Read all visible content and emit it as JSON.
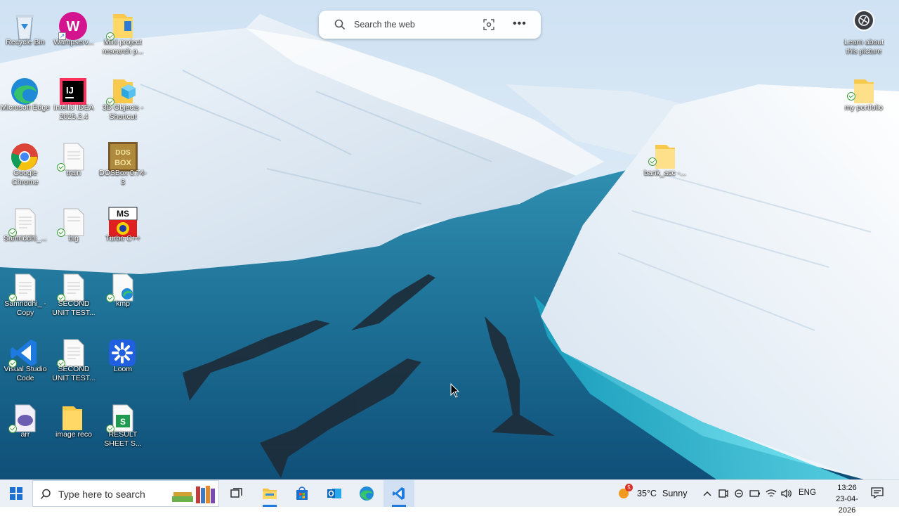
{
  "desktop": {
    "icons": [
      {
        "label": "Recycle Bin"
      },
      {
        "label": "Wampserv..."
      },
      {
        "label": "Mini project research p..."
      },
      {
        "label": "Microsoft Edge"
      },
      {
        "label": "IntelliJ IDEA 2025.2.4"
      },
      {
        "label": "3D Objects - Shortcut"
      },
      {
        "label": "Google Chrome"
      },
      {
        "label": "train"
      },
      {
        "label": "DOSBox 0.74-3"
      },
      {
        "label": "Samriddhi_..."
      },
      {
        "label": "big"
      },
      {
        "label": "Turbo C++"
      },
      {
        "label": "Samriddhi_ - Copy"
      },
      {
        "label": "SECOND UNIT TEST..."
      },
      {
        "label": "kmp"
      },
      {
        "label": "Visual Studio Code"
      },
      {
        "label": "SECOND UNIT TEST..."
      },
      {
        "label": "Loom"
      },
      {
        "label": "arr"
      },
      {
        "label": "image reco"
      },
      {
        "label": "RESULT SHEET S..."
      },
      {
        "label": "my portfolio"
      },
      {
        "label": "bank_acc -..."
      }
    ]
  },
  "search_widget": {
    "placeholder": "Search the web",
    "more": "•••"
  },
  "learn_about": {
    "label": "Learn about this picture"
  },
  "taskbar": {
    "search_placeholder": "Type here to search",
    "apps": [
      "file-explorer",
      "microsoft-store",
      "outlook",
      "edge",
      "vs-code"
    ],
    "weather": {
      "temp": "35°C",
      "condition": "Sunny",
      "badge": "5"
    },
    "language": "ENG",
    "time": "13:26",
    "date": "23-04-2026"
  },
  "colors": {
    "accent": "#1f7ae0",
    "taskbar_bg": "#eaf0f6"
  }
}
